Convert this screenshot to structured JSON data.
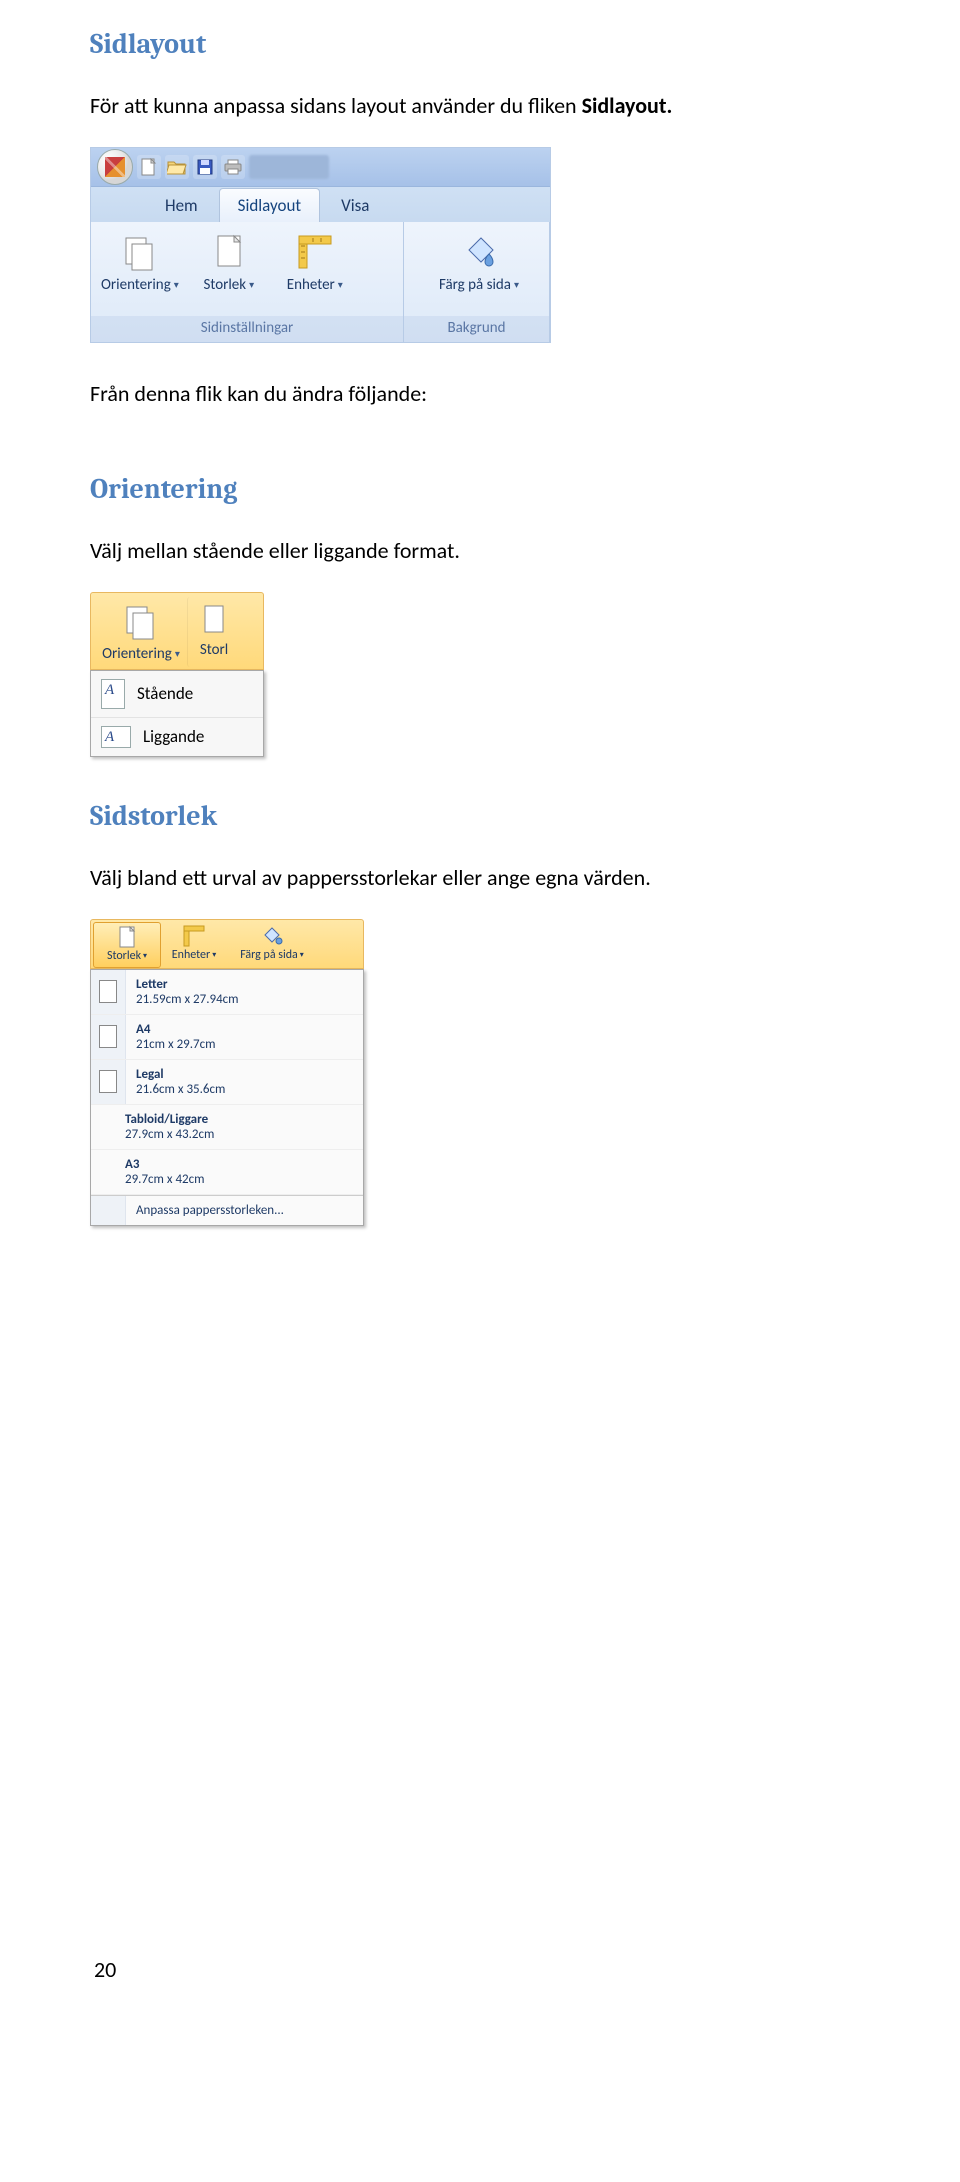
{
  "headings": {
    "sidlayout": "Sidlayout",
    "orientering": "Orientering",
    "sidstorlek": "Sidstorlek"
  },
  "paragraphs": {
    "intro_pre": "För att kunna anpassa sidans layout använder du fliken ",
    "intro_bold": "Sidlayout.",
    "fran_flik": "Från denna flik kan du ändra följande:",
    "orient_text": "Välj mellan stående eller liggande format.",
    "size_text": "Välj bland ett urval av pappersstorlekar eller ange egna värden."
  },
  "ribbon1": {
    "tabs": [
      "Hem",
      "Sidlayout",
      "Visa"
    ],
    "active_tab_index": 1,
    "group1": {
      "caption": "Sidinställningar",
      "buttons": [
        {
          "name": "orientering-button",
          "label": "Orientering",
          "dd": true
        },
        {
          "name": "storlek-button",
          "label": "Storlek",
          "dd": true
        },
        {
          "name": "enheter-button",
          "label": "Enheter",
          "dd": true
        }
      ]
    },
    "group2": {
      "caption": "Bakgrund",
      "buttons": [
        {
          "name": "farg-pa-sida-button",
          "label": "Färg på sida",
          "dd": true
        }
      ]
    }
  },
  "orient_menu": {
    "button_label": "Orientering",
    "half_label": "Storl",
    "items": [
      {
        "name": "staende-option",
        "label": "Stående",
        "landscape": false
      },
      {
        "name": "liggande-option",
        "label": "Liggande",
        "landscape": true
      }
    ]
  },
  "size_menu": {
    "top": [
      {
        "name": "storlek-top-button",
        "label": "Storlek",
        "dd": true
      },
      {
        "name": "enheter-top-button",
        "label": "Enheter",
        "dd": true
      },
      {
        "name": "farg-top-button",
        "label": "Färg på sida",
        "dd": true
      }
    ],
    "items": [
      {
        "name": "letter-size",
        "label": "Letter",
        "dim": "21.59cm x 27.94cm"
      },
      {
        "name": "a4-size",
        "label": "A4",
        "dim": "21cm x 29.7cm"
      },
      {
        "name": "legal-size",
        "label": "Legal",
        "dim": "21.6cm x 35.6cm"
      },
      {
        "name": "tabloid-size",
        "label": "Tabloid/Liggare",
        "dim": "27.9cm x 43.2cm"
      },
      {
        "name": "a3-size",
        "label": "A3",
        "dim": "29.7cm x 42cm"
      }
    ],
    "footer": "Anpassa pappersstorleken..."
  },
  "page_number": "20"
}
